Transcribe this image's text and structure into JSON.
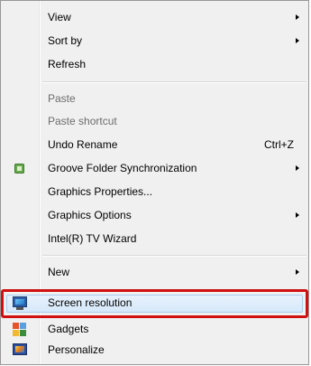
{
  "menu": {
    "items": [
      {
        "label": "View",
        "submenu": true
      },
      {
        "label": "Sort by",
        "submenu": true
      },
      {
        "label": "Refresh"
      },
      {
        "label": "Paste",
        "disabled": true
      },
      {
        "label": "Paste shortcut",
        "disabled": true
      },
      {
        "label": "Undo Rename",
        "shortcut": "Ctrl+Z"
      },
      {
        "label": "Groove Folder Synchronization",
        "submenu": true,
        "icon": "groove-folder-icon"
      },
      {
        "label": "Graphics Properties..."
      },
      {
        "label": "Graphics Options",
        "submenu": true
      },
      {
        "label": "Intel(R) TV Wizard"
      },
      {
        "label": "New",
        "submenu": true
      },
      {
        "label": "Screen resolution",
        "icon": "screen-resolution-icon",
        "highlighted": true
      },
      {
        "label": "Gadgets",
        "icon": "gadgets-icon"
      },
      {
        "label": "Personalize",
        "icon": "personalize-icon"
      }
    ]
  },
  "colors": {
    "menu_bg": "#f0f0f0",
    "highlight_border": "#d01010",
    "disabled_text": "#6d6d6d"
  }
}
